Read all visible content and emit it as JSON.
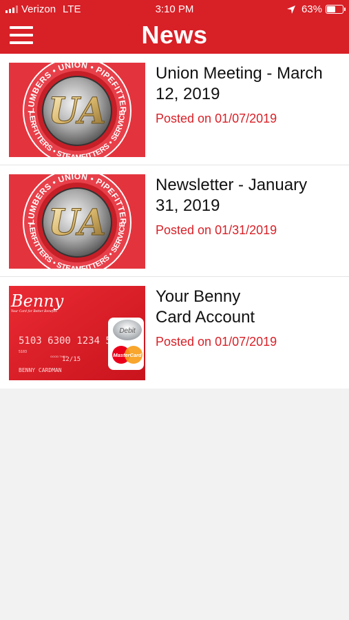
{
  "status_bar": {
    "carrier": "Verizon",
    "network": "LTE",
    "time": "3:10 PM",
    "battery": "63%",
    "battery_level": 0.63
  },
  "header": {
    "title": "News",
    "menu_icon": "hamburger-menu-icon"
  },
  "news": [
    {
      "title": "Union Meeting - March\n12, 2019",
      "date": "Posted on 01/07/2019",
      "thumbnail": "ua-union-seal"
    },
    {
      "title": "Newsletter - January\n31, 2019",
      "date": "Posted on 01/31/2019",
      "thumbnail": "ua-union-seal"
    },
    {
      "title": "Your Benny\nCard Account",
      "date": "Posted on 01/07/2019",
      "thumbnail": "benny-card"
    }
  ],
  "seal_text": {
    "top": "PLUMBERS • UNION • PIPEFITTERS",
    "bottom": "SPRINKLERFITTERS • STEAMFITTERS • SERVICE TECHS",
    "logo": "UA"
  },
  "benny_card": {
    "brand": "Benny",
    "tagline": "Your Card for Better Benefits",
    "number": "5103 6300 1234 5678",
    "code": "5103",
    "expiry_label": "GOOD THRU",
    "expiry": "12/15",
    "holder": "BENNY CARDMAN",
    "debit": "Debit",
    "network": "MasterCard"
  },
  "colors": {
    "header": "#d82027",
    "date_text": "#d82027",
    "background": "#f2f2f2"
  }
}
